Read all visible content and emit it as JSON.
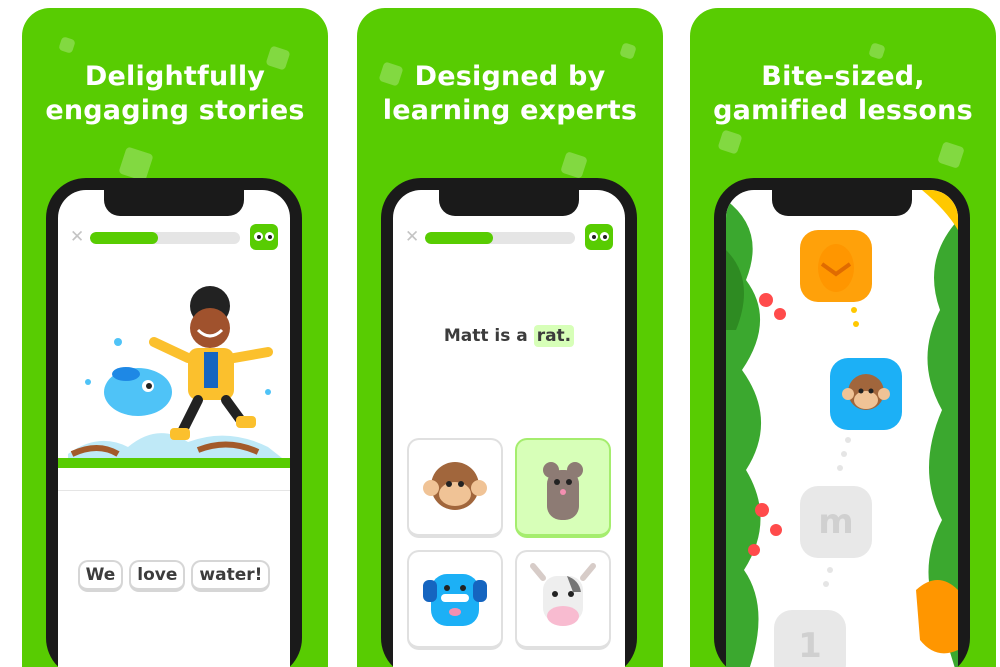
{
  "panels": [
    {
      "headline_line1": "Delightfully",
      "headline_line2": "engaging stories",
      "progress": 0.45,
      "words": [
        "We",
        "love",
        "water!"
      ]
    },
    {
      "headline_line1": "Designed by",
      "headline_line2": "learning experts",
      "progress": 0.45,
      "sentence_prefix": "Matt is a",
      "sentence_highlight": "rat."
    },
    {
      "headline_line1": "Bite-sized,",
      "headline_line2": "gamified lessons",
      "lesson_letter": "m",
      "lesson_number": "1"
    }
  ],
  "icons": {
    "close": "close-icon",
    "owl": "duo-owl-icon",
    "monkey": "monkey-icon",
    "rat": "rat-icon",
    "dog": "dog-icon",
    "cow": "cow-icon",
    "egg": "egg-icon"
  },
  "colors": {
    "brand_green": "#58cc02",
    "progress_track": "#e5e5e5",
    "selected_card": "#d7ffb8",
    "highlight": "#d7ffb8",
    "egg_orange": "#ffa10a",
    "lesson_blue": "#1cb0f6",
    "locked_grey": "#e8e8e8"
  }
}
